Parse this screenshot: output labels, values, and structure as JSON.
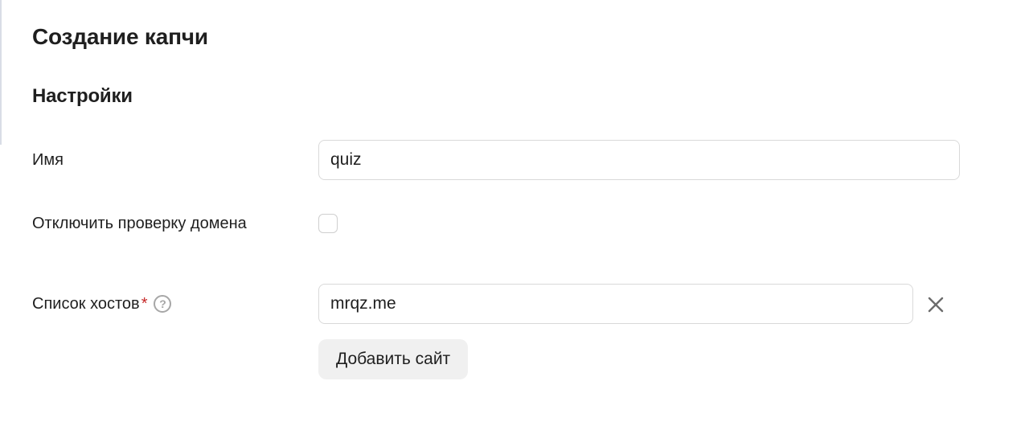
{
  "page": {
    "title": "Создание капчи"
  },
  "settings": {
    "section_title": "Настройки",
    "name_label": "Имя",
    "name_value": "quiz",
    "disable_domain_check_label": "Отключить проверку домена",
    "disable_domain_check_checked": false,
    "hosts_label": "Список хостов",
    "hosts_required_mark": "*",
    "hosts_help_icon": "?",
    "hosts": [
      "mrqz.me"
    ],
    "remove_icon": "close-icon",
    "add_site_label": "Добавить сайт"
  },
  "colors": {
    "required_star": "#c62828",
    "button_bg": "#f0f0f0",
    "border": "#d9d9d9"
  }
}
